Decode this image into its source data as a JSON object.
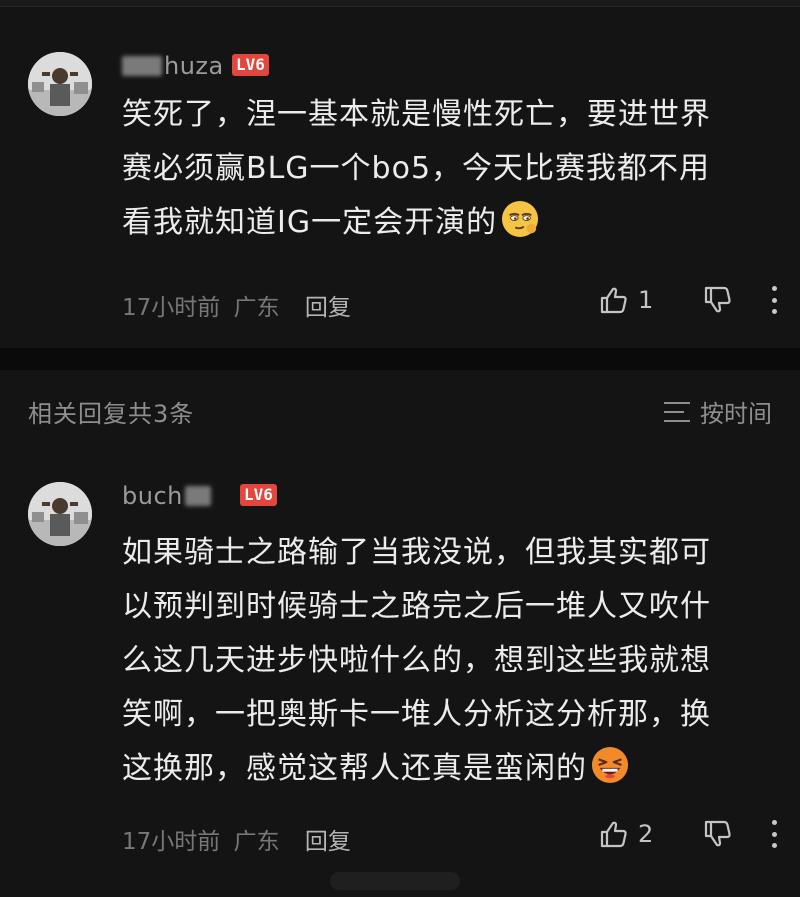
{
  "comments": [
    {
      "username": "huza",
      "level": "LV6",
      "content_lines": [
        "笑死了，涅一基本就是慢性死亡，要进世界",
        "赛必须赢BLG一个bo5，今天比赛我都不用",
        "看我就知道IG一定会开演的"
      ],
      "emoji": "smirk-emoji",
      "time": "17小时前",
      "location": "广东",
      "reply_label": "回复",
      "likes": "1"
    }
  ],
  "replies_header": {
    "title": "相关回复共3条",
    "sort_label": "按时间",
    "sort_icon": "sort-lines-icon"
  },
  "replies": [
    {
      "username": "buch",
      "level": "LV6",
      "content_lines": [
        "如果骑士之路输了当我没说，但我其实都可",
        "以预判到时候骑士之路完之后一堆人又吹什",
        "么这几天进步快啦什么的，想到这些我就想",
        "笑啊，一把奥斯卡一堆人分析这分析那，换",
        "这换那，感觉这帮人还真是蛮闲的"
      ],
      "emoji": "laughing-emoji",
      "time": "17小时前",
      "location": "广东",
      "reply_label": "回复",
      "likes": "2"
    }
  ],
  "colors": {
    "background": "#141414",
    "level_badge": "#e2463c",
    "text": "#ececec",
    "meta": "#777777"
  }
}
